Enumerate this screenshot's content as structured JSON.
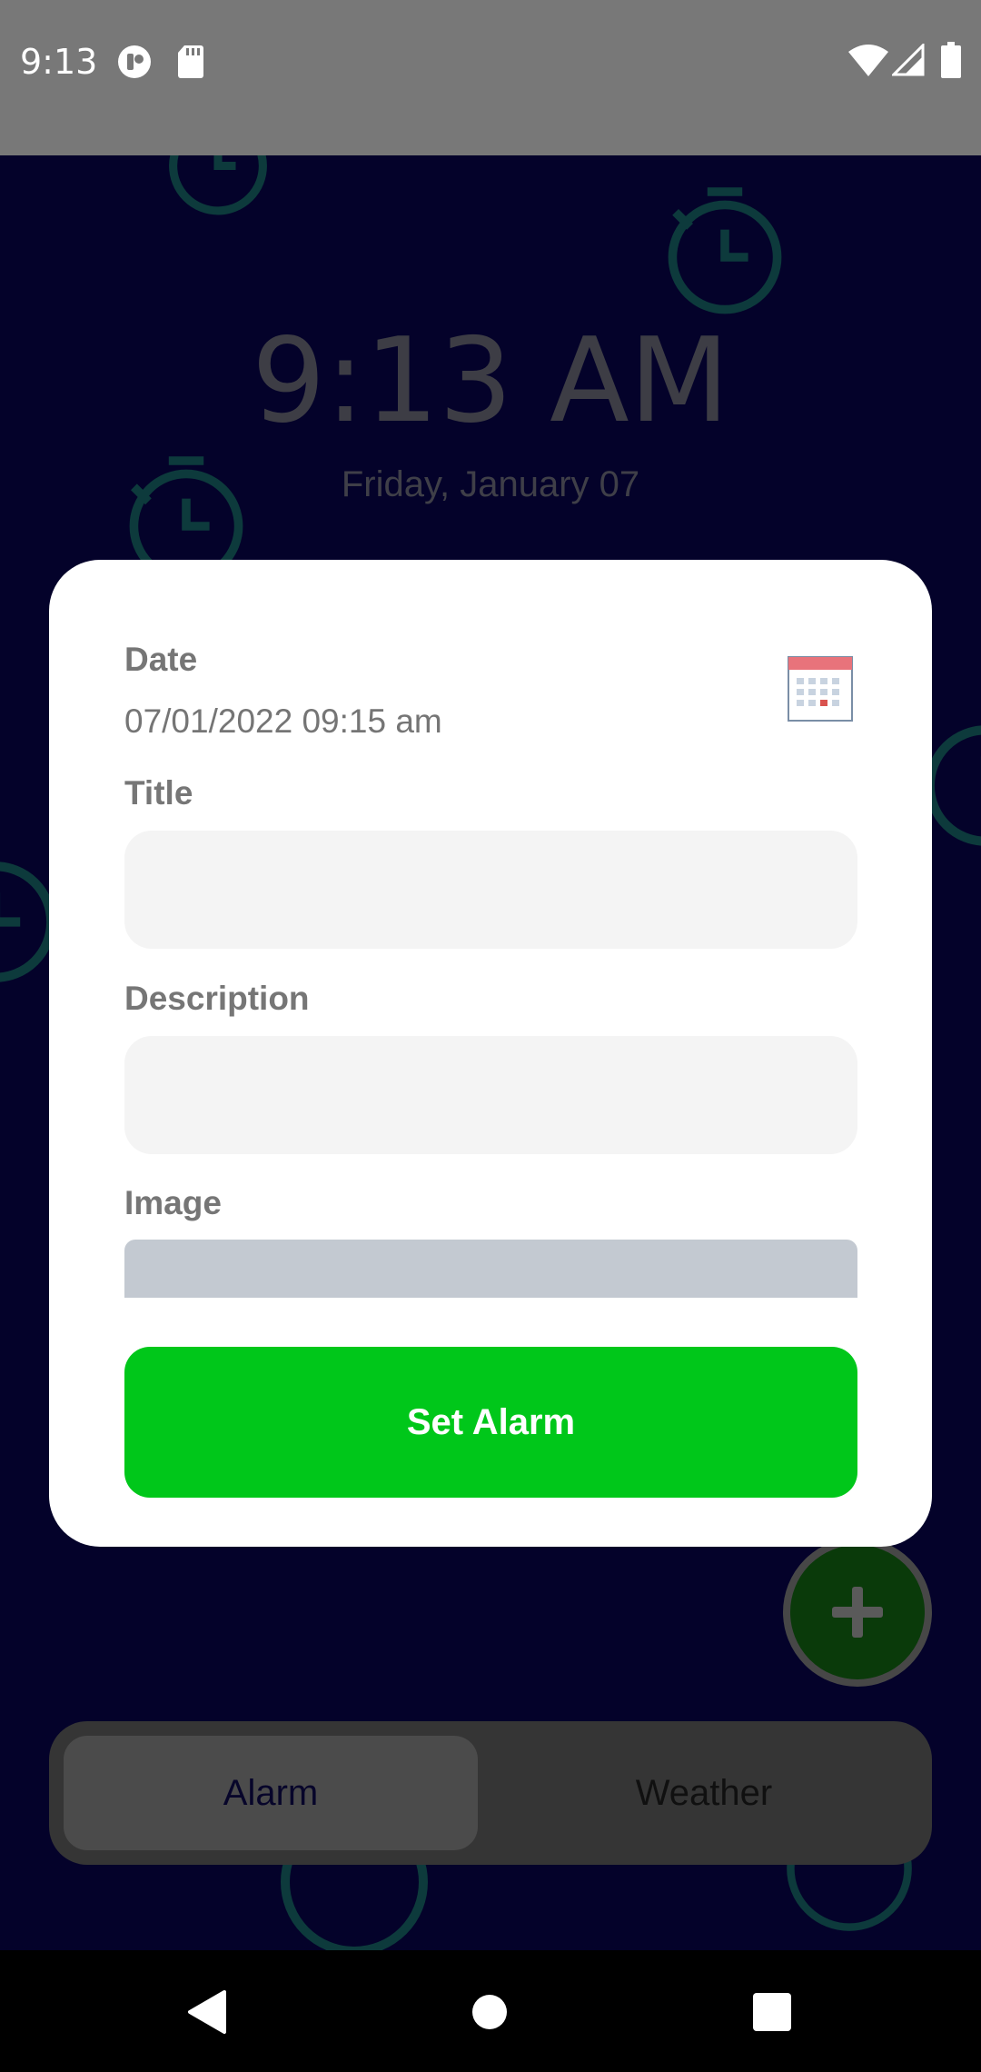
{
  "status_bar": {
    "time": "9:13",
    "icons": [
      "notification-app-icon",
      "sd-card-icon",
      "wifi-icon",
      "signal-icon",
      "battery-icon"
    ]
  },
  "header": {
    "time": "9:13 AM",
    "date": "Friday, January 07"
  },
  "dialog": {
    "date_label": "Date",
    "date_value": "07/01/2022 09:15 am",
    "title_label": "Title",
    "title_value": "",
    "description_label": "Description",
    "description_value": "",
    "image_label": "Image",
    "submit_label": "Set Alarm"
  },
  "fab": {
    "icon": "plus-icon"
  },
  "tabs": [
    {
      "label": "Alarm",
      "selected": true
    },
    {
      "label": "Weather",
      "selected": false
    }
  ],
  "nav": {
    "icons": [
      "back-icon",
      "home-icon",
      "recents-icon"
    ]
  },
  "colors": {
    "background": "#04022a",
    "status_bar": "#787878",
    "button": "#00c71a",
    "field": "#f4f4f4",
    "tab_bar": "#353535"
  }
}
